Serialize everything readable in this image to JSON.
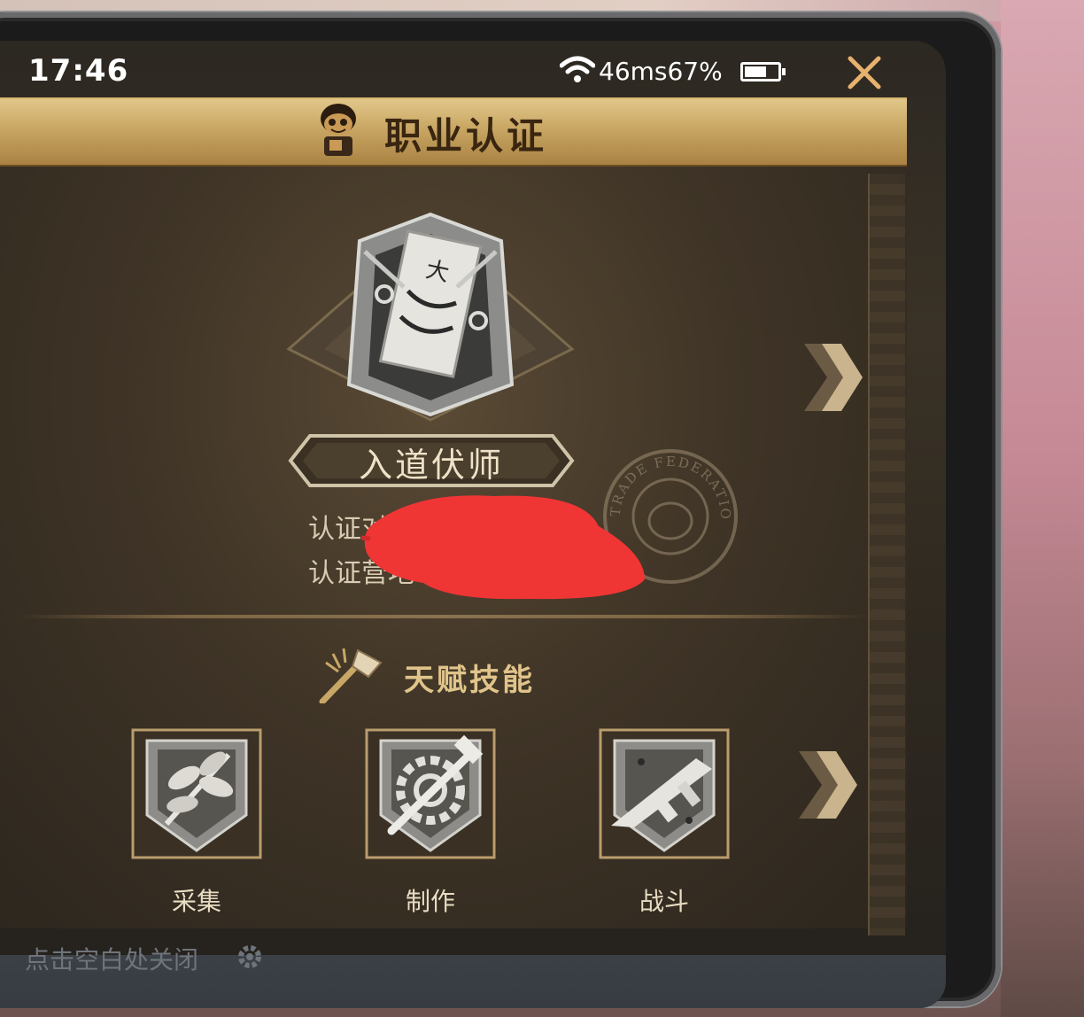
{
  "status_bar": {
    "time": "17:46",
    "network": "46ms67%",
    "battery_level": 0.67,
    "icons": [
      "wifi-icon",
      "battery-icon"
    ]
  },
  "header": {
    "title": "职业认证",
    "close_icon": "close-icon",
    "mascot_icon": "mascot-icon"
  },
  "certification": {
    "rank_name": "入道伏师",
    "line1_prefix": "认证对",
    "line2_prefix": "认证营地",
    "stamp_text": "TRADE FEDERATION"
  },
  "talent": {
    "section_title": "天赋技能",
    "skills": [
      {
        "label": "采集",
        "icon": "leaves-icon"
      },
      {
        "label": "制作",
        "icon": "gear-hammer-icon"
      },
      {
        "label": "战斗",
        "icon": "submachine-gun-icon"
      }
    ]
  },
  "footer": {
    "hint": "点击空白处关闭",
    "settings_icon": "gear-icon"
  },
  "colors": {
    "banner_gold": "#c9a764",
    "accent_text": "#e0c48a",
    "panel_dark": "#3f3426"
  }
}
